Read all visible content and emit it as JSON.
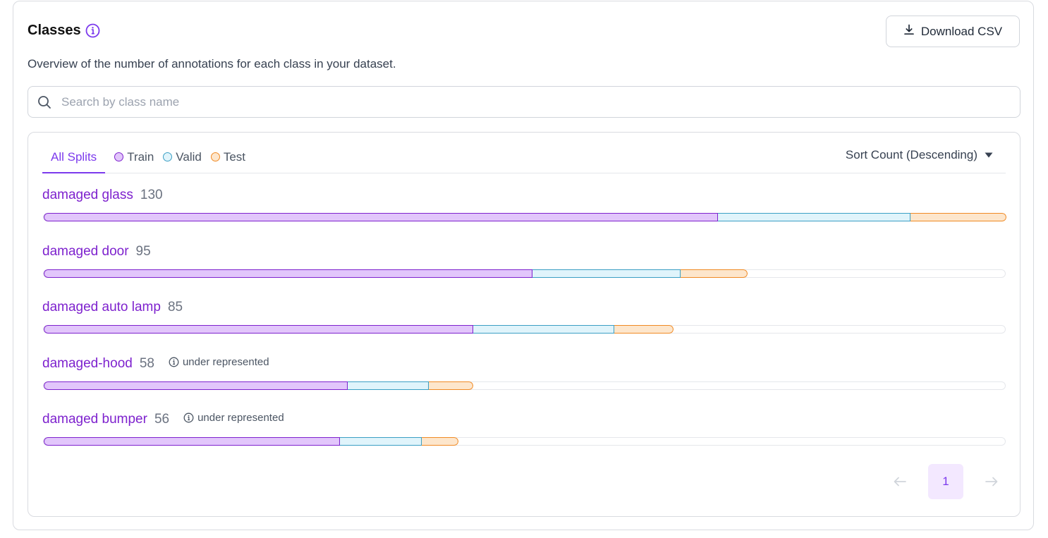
{
  "header": {
    "title": "Classes",
    "subtitle": "Overview of the number of annotations for each class in your dataset.",
    "download_label": "Download CSV"
  },
  "search": {
    "placeholder": "Search by class name",
    "value": ""
  },
  "tabs": {
    "all_label": "All Splits",
    "train_label": "Train",
    "valid_label": "Valid",
    "test_label": "Test"
  },
  "sort": {
    "label": "Sort Count (Descending)"
  },
  "colors": {
    "accent": "#7c3aed",
    "train": "#e2c6fb",
    "valid": "#e0f4fb",
    "test": "#fde6cc"
  },
  "max_count": 130,
  "classes": [
    {
      "name": "damaged glass",
      "count": "130",
      "note": "",
      "train": 91,
      "valid": 26,
      "test": 13
    },
    {
      "name": "damaged door",
      "count": "95",
      "note": "",
      "train": 66,
      "valid": 20,
      "test": 9
    },
    {
      "name": "damaged auto lamp",
      "count": "85",
      "note": "",
      "train": 58,
      "valid": 19,
      "test": 8
    },
    {
      "name": "damaged-hood",
      "count": "58",
      "note": "under represented",
      "train": 41,
      "valid": 11,
      "test": 6
    },
    {
      "name": "damaged bumper",
      "count": "56",
      "note": "under represented",
      "train": 40,
      "valid": 11,
      "test": 5
    }
  ],
  "pagination": {
    "current_page": "1"
  }
}
